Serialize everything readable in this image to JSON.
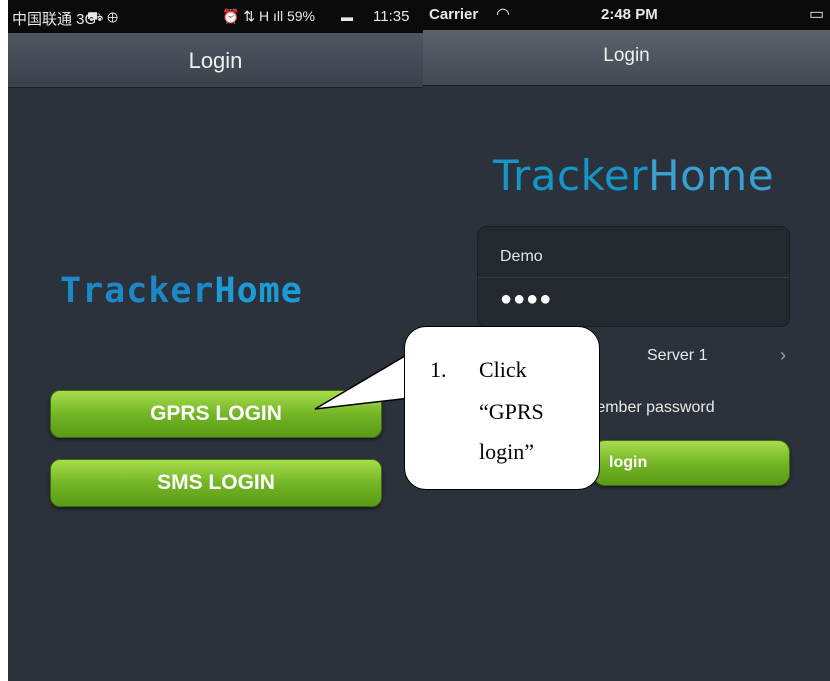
{
  "left_screen": {
    "status": {
      "carrier": "中国联通 3G",
      "icons": "⏰ ⇅ H ıll 59%",
      "time": "11:35"
    },
    "title": "Login",
    "logo": {
      "part1": "Tracker",
      "part2": "Home"
    },
    "buttons": {
      "gprs": "GPRS LOGIN",
      "sms": "SMS LOGIN"
    }
  },
  "right_screen": {
    "status": {
      "carrier": "Carrier",
      "time": "2:48 PM"
    },
    "title": "Login",
    "logo": {
      "part1": "Tracker",
      "part2": "Home"
    },
    "username": "Demo",
    "password_mask": "●●●●",
    "server": "Server 1",
    "remember": "member password",
    "login": "login"
  },
  "callout": {
    "number": "1.",
    "line1": "Click",
    "line2": "“GPRS",
    "line3": "login”"
  },
  "colors": {
    "accent_green": "#74b625",
    "logo_blue": "#1d88c7",
    "background": "#2c323b"
  }
}
